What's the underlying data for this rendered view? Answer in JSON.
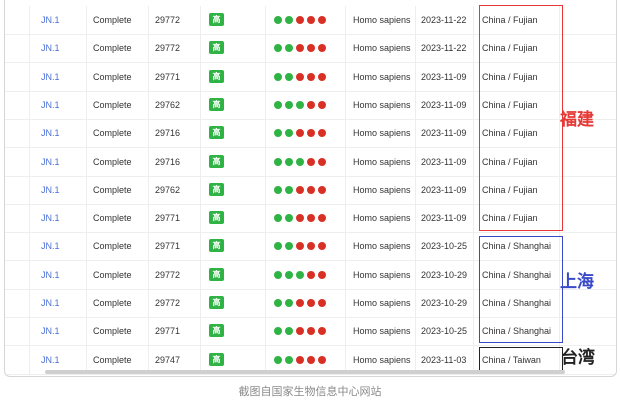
{
  "colors": {
    "dot_green": "#2fb344",
    "dot_red": "#d93025",
    "badge_green": "#2fb344",
    "fujian_red": "#e53935",
    "shanghai_blue": "#3949c8",
    "taiwan_black": "#222222",
    "link_blue": "#4a6fd6"
  },
  "badge_glyph": "高",
  "rows": [
    {
      "lineage": "JN.1",
      "status": "Complete",
      "length": "29772",
      "dots": [
        "green",
        "green",
        "red",
        "red",
        "red"
      ],
      "host": "Homo sapiens",
      "date": "2023-11-22",
      "location": "China / Fujian"
    },
    {
      "lineage": "JN.1",
      "status": "Complete",
      "length": "29772",
      "dots": [
        "green",
        "green",
        "red",
        "red",
        "red"
      ],
      "host": "Homo sapiens",
      "date": "2023-11-22",
      "location": "China / Fujian"
    },
    {
      "lineage": "JN.1",
      "status": "Complete",
      "length": "29771",
      "dots": [
        "green",
        "green",
        "red",
        "red",
        "red"
      ],
      "host": "Homo sapiens",
      "date": "2023-11-09",
      "location": "China / Fujian"
    },
    {
      "lineage": "JN.1",
      "status": "Complete",
      "length": "29762",
      "dots": [
        "green",
        "green",
        "green",
        "red",
        "red"
      ],
      "host": "Homo sapiens",
      "date": "2023-11-09",
      "location": "China / Fujian"
    },
    {
      "lineage": "JN.1",
      "status": "Complete",
      "length": "29716",
      "dots": [
        "green",
        "green",
        "red",
        "red",
        "red"
      ],
      "host": "Homo sapiens",
      "date": "2023-11-09",
      "location": "China / Fujian"
    },
    {
      "lineage": "JN.1",
      "status": "Complete",
      "length": "29716",
      "dots": [
        "green",
        "green",
        "green",
        "red",
        "red"
      ],
      "host": "Homo sapiens",
      "date": "2023-11-09",
      "location": "China / Fujian"
    },
    {
      "lineage": "JN.1",
      "status": "Complete",
      "length": "29762",
      "dots": [
        "green",
        "green",
        "red",
        "red",
        "red"
      ],
      "host": "Homo sapiens",
      "date": "2023-11-09",
      "location": "China / Fujian"
    },
    {
      "lineage": "JN.1",
      "status": "Complete",
      "length": "29771",
      "dots": [
        "green",
        "green",
        "red",
        "red",
        "red"
      ],
      "host": "Homo sapiens",
      "date": "2023-11-09",
      "location": "China / Fujian"
    },
    {
      "lineage": "JN.1",
      "status": "Complete",
      "length": "29771",
      "dots": [
        "green",
        "green",
        "red",
        "red",
        "red"
      ],
      "host": "Homo sapiens",
      "date": "2023-10-25",
      "location": "China / Shanghai"
    },
    {
      "lineage": "JN.1",
      "status": "Complete",
      "length": "29772",
      "dots": [
        "green",
        "green",
        "green",
        "red",
        "red"
      ],
      "host": "Homo sapiens",
      "date": "2023-10-29",
      "location": "China / Shanghai"
    },
    {
      "lineage": "JN.1",
      "status": "Complete",
      "length": "29772",
      "dots": [
        "green",
        "green",
        "red",
        "red",
        "red"
      ],
      "host": "Homo sapiens",
      "date": "2023-10-29",
      "location": "China / Shanghai"
    },
    {
      "lineage": "JN.1",
      "status": "Complete",
      "length": "29771",
      "dots": [
        "green",
        "green",
        "red",
        "red",
        "red"
      ],
      "host": "Homo sapiens",
      "date": "2023-10-25",
      "location": "China / Shanghai"
    },
    {
      "lineage": "JN.1",
      "status": "Complete",
      "length": "29747",
      "dots": [
        "green",
        "green",
        "red",
        "red",
        "red"
      ],
      "host": "Homo sapiens",
      "date": "2023-11-03",
      "location": "China / Taiwan"
    }
  ],
  "annotations": {
    "fujian": "福建",
    "shanghai": "上海",
    "taiwan": "台湾"
  },
  "caption": "截图自国家生物信息中心网站"
}
